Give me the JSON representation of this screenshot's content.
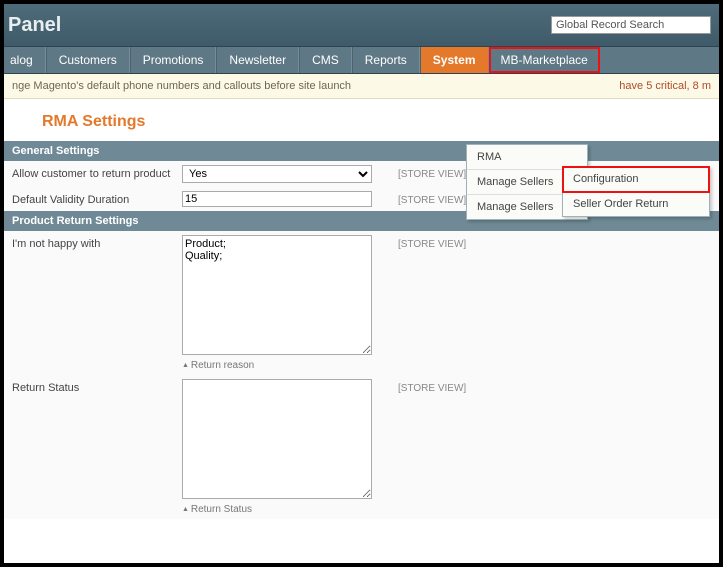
{
  "header": {
    "title": "Panel",
    "search_placeholder": "Global Record Search"
  },
  "nav": {
    "items": [
      "alog",
      "Customers",
      "Promotions",
      "Newsletter",
      "CMS",
      "Reports",
      "System",
      "MB-Marketplace"
    ],
    "active_index": 6,
    "highlight_index": 7
  },
  "dropdown": {
    "items": [
      "RMA",
      "Manage Sellers",
      "Manage Sellers"
    ]
  },
  "submenu": {
    "items": [
      "Configuration",
      "Seller Order Return"
    ],
    "highlight_index": 0
  },
  "notice": {
    "text": "nge Magento's default phone numbers and callouts before site launch",
    "right": "have 5 critical, 8 m"
  },
  "page": {
    "title": "RMA Settings"
  },
  "sections": {
    "general": {
      "title": "General Settings",
      "rows": [
        {
          "label": "Allow customer to return product",
          "type": "select",
          "value": "Yes",
          "scope": "[STORE VIEW]"
        },
        {
          "label": "Default Validity Duration",
          "type": "text",
          "value": "15",
          "scope": "[STORE VIEW]"
        }
      ]
    },
    "product_return": {
      "title": "Product Return Settings",
      "rows": [
        {
          "label": "I'm not happy with",
          "type": "textarea",
          "value": "Product;\nQuality;",
          "hint": "Return reason",
          "scope": "[STORE VIEW]"
        },
        {
          "label": "Return Status",
          "type": "textarea",
          "value": "",
          "hint": "Return Status",
          "scope": "[STORE VIEW]"
        }
      ]
    }
  }
}
